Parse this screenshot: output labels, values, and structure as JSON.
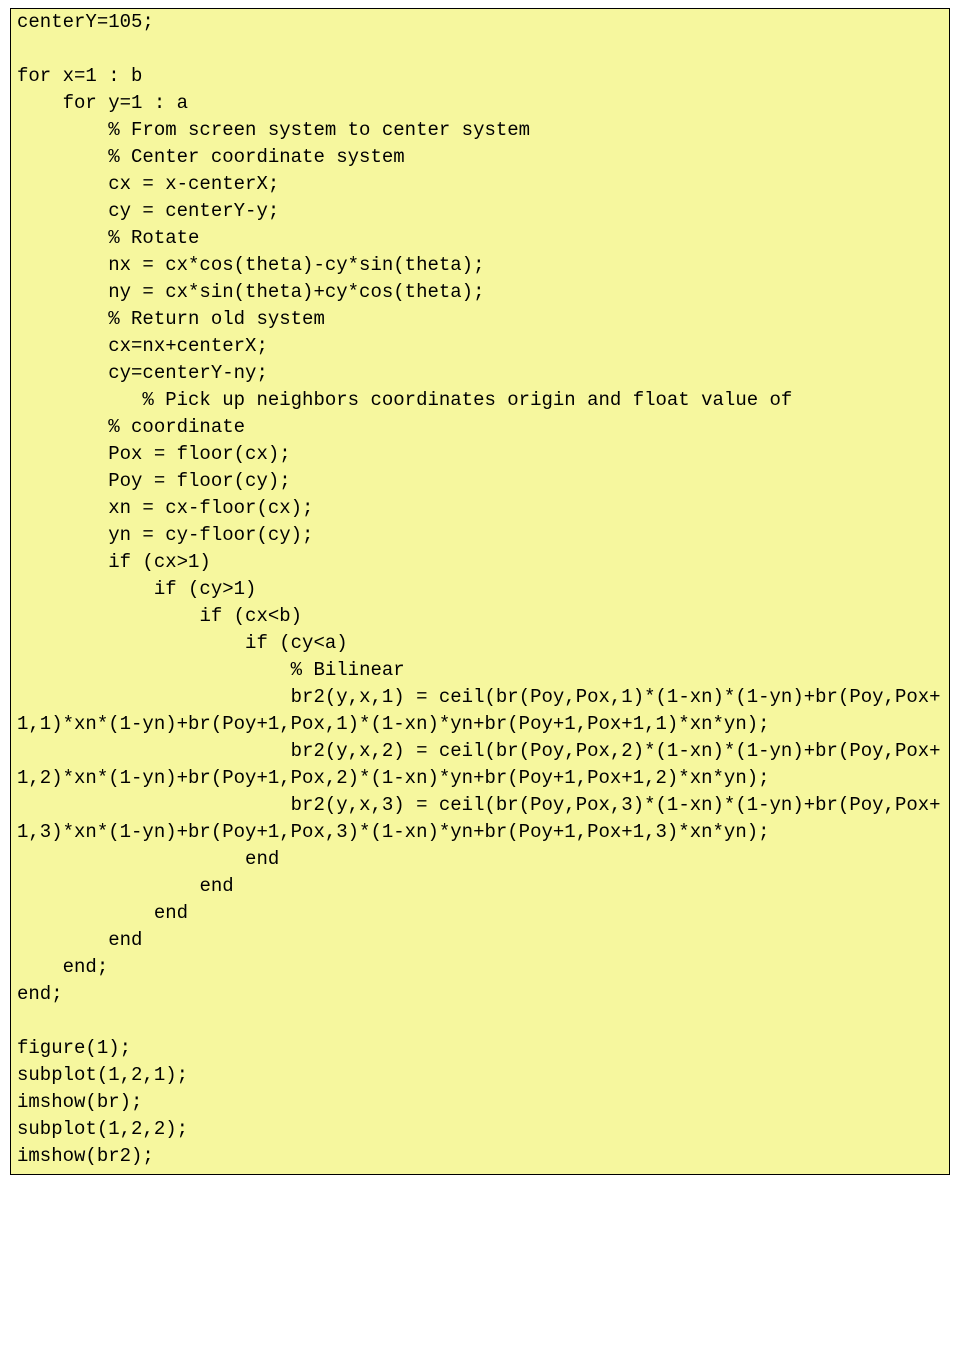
{
  "code": "centerY=105;\n\nfor x=1 : b\n    for y=1 : a\n        % From screen system to center system\n        % Center coordinate system\n        cx = x-centerX;\n        cy = centerY-y;\n        % Rotate\n        nx = cx*cos(theta)-cy*sin(theta);\n        ny = cx*sin(theta)+cy*cos(theta);\n        % Return old system\n        cx=nx+centerX;\n        cy=centerY-ny;\n           % Pick up neighbors coordinates origin and float value of \n        % coordinate\n        Pox = floor(cx);\n        Poy = floor(cy);\n        xn = cx-floor(cx);\n        yn = cy-floor(cy);\n        if (cx>1)\n            if (cy>1)\n                if (cx<b)\n                    if (cy<a)\n                        % Bilinear\n                        br2(y,x,1) = ceil(br(Poy,Pox,1)*(1-xn)*(1-yn)+br(Poy,Pox+1,1)*xn*(1-yn)+br(Poy+1,Pox,1)*(1-xn)*yn+br(Poy+1,Pox+1,1)*xn*yn);\n                        br2(y,x,2) = ceil(br(Poy,Pox,2)*(1-xn)*(1-yn)+br(Poy,Pox+1,2)*xn*(1-yn)+br(Poy+1,Pox,2)*(1-xn)*yn+br(Poy+1,Pox+1,2)*xn*yn);\n                        br2(y,x,3) = ceil(br(Poy,Pox,3)*(1-xn)*(1-yn)+br(Poy,Pox+1,3)*xn*(1-yn)+br(Poy+1,Pox,3)*(1-xn)*yn+br(Poy+1,Pox+1,3)*xn*yn);\n                    end\n                end\n            end\n        end\n    end;\nend;\n\nfigure(1);\nsubplot(1,2,1);\nimshow(br);\nsubplot(1,2,2);\nimshow(br2);"
}
